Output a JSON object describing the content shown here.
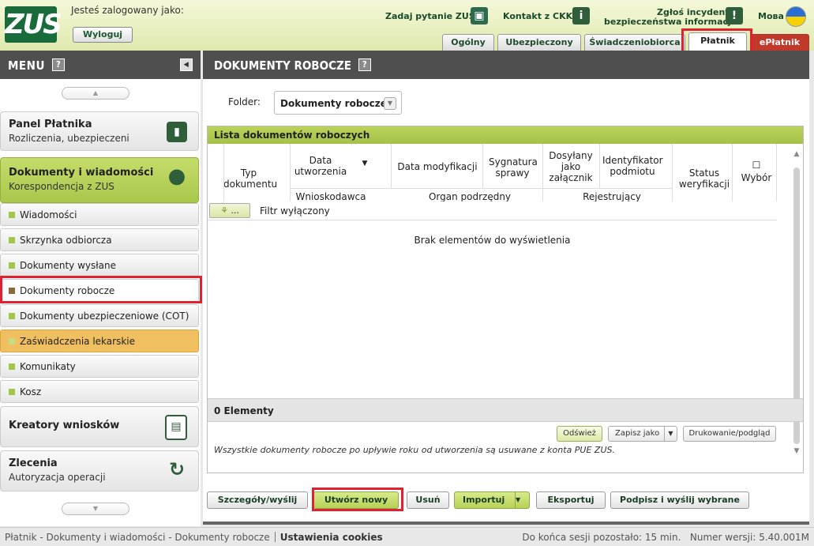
{
  "header": {
    "logo_text": "ZUS",
    "logged_in_label": "Jesteś zalogowany jako:",
    "logout_label": "Wyloguj",
    "ask_zus_label": "Zadaj pytanie ZUS",
    "contact_label": "Kontakt z CKK",
    "incident_line1": "Zgłoś incydent",
    "incident_line2": "bezpieczeństwa informacji",
    "language_label": "Мова",
    "tabs": [
      {
        "label": "Ogólny"
      },
      {
        "label": "Ubezpieczony"
      },
      {
        "label": "Świadczeniobiorca"
      },
      {
        "label": "Płatnik"
      },
      {
        "label": "ePłatnik"
      }
    ]
  },
  "sidebar": {
    "title": "MENU",
    "help": "?",
    "panels": [
      {
        "title": "Panel Płatnika",
        "subtitle": "Rozliczenia, ubezpieczeni"
      },
      {
        "title": "Dokumenty i wiadomości",
        "subtitle": "Korespondencja z ZUS"
      }
    ],
    "items": [
      {
        "label": "Wiadomości"
      },
      {
        "label": "Skrzynka odbiorcza"
      },
      {
        "label": "Dokumenty wysłane"
      },
      {
        "label": "Dokumenty robocze"
      },
      {
        "label": "Dokumenty ubezpieczeniowe (COT)"
      },
      {
        "label": "Zaświadczenia lekarskie"
      },
      {
        "label": "Komunikaty"
      },
      {
        "label": "Kosz"
      }
    ],
    "bottom_panels": [
      {
        "title": "Kreatory wniosków"
      },
      {
        "title": "Zlecenia",
        "subtitle": "Autoryzacja operacji"
      }
    ]
  },
  "main": {
    "title": "DOKUMENTY ROBOCZE",
    "help": "?",
    "folder_label": "Folder:",
    "folder_value": "Dokumenty robocze",
    "list_title": "Lista dokumentów roboczych",
    "columns": {
      "typ": "Typ dokumentu",
      "data_utw": "Data utworzenia",
      "data_mod": "Data modyfikacji",
      "sygnatura": "Sygnatura sprawy",
      "dosylany": "Dosyłany jako załącznik",
      "identyfikator": "Identyfikator podmiotu",
      "status": "Status weryfikacji",
      "wybor": "Wybór",
      "wnioskodawca": "Wnioskodawca",
      "organ": "Organ podrzędny",
      "rejestrujacy": "Rejestrujący"
    },
    "filter_btn": "...",
    "filter_text": "Filtr wyłączony",
    "empty_text": "Brak elementów do wyświetlenia",
    "count_text": "0 Elementy",
    "refresh_label": "Odśwież",
    "save_as_label": "Zapisz jako",
    "print_label": "Drukowanie/podgląd",
    "note": "Wszystkie dokumenty robocze po upływie roku od utworzenia są usuwane z konta PUE ZUS.",
    "actions": {
      "details": "Szczegóły/wyślij",
      "create": "Utwórz nowy",
      "delete": "Usuń",
      "import": "Importuj",
      "export": "Eksportuj",
      "sign_send": "Podpisz i wyślij wybrane"
    }
  },
  "footer": {
    "breadcrumb": "Płatnik - Dokumenty i wiadomości - Dokumenty robocze",
    "cookies": "Ustawienia cookies",
    "session": "Do końca sesji pozostało: 15 min.",
    "version": "Numer wersji: 5.40.001M"
  },
  "colors": {
    "brand_green": "#1a6b3c",
    "menu_dark": "#4f4f4f",
    "highlight_red": "#e0212f",
    "accent_lime": "#a9c74b"
  }
}
